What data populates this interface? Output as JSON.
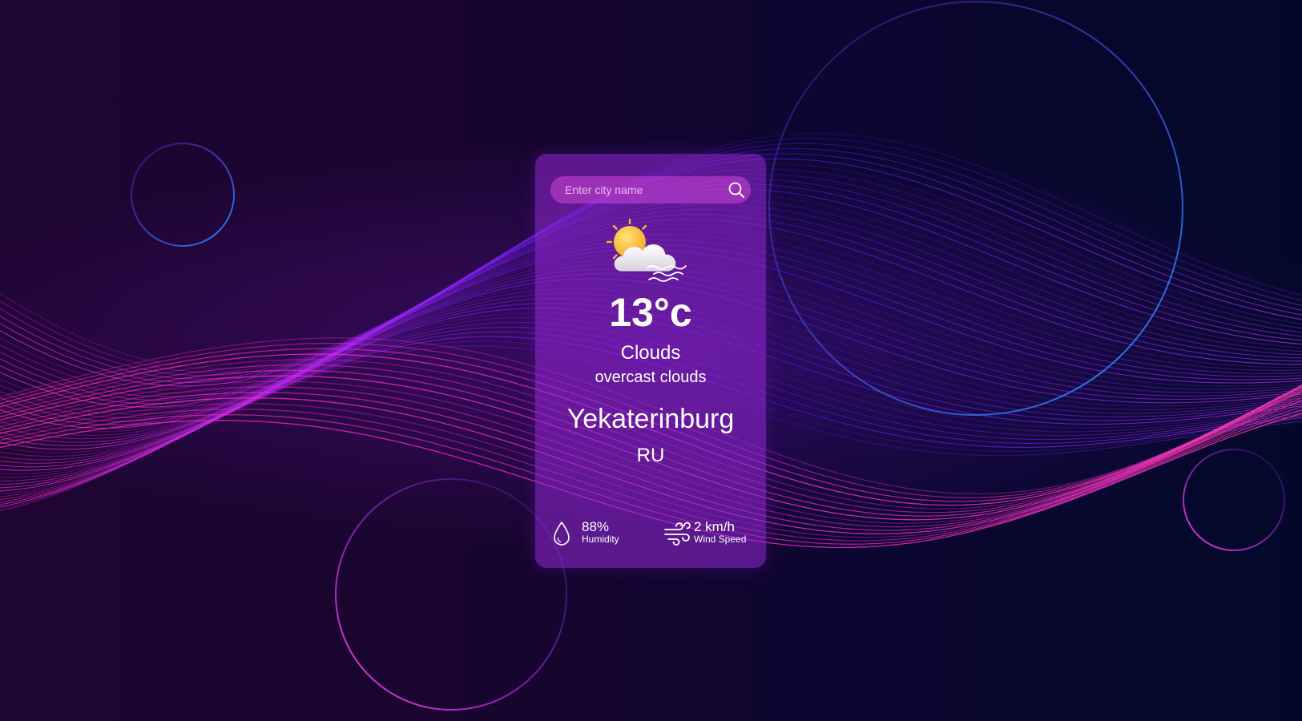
{
  "search": {
    "placeholder": "Enter city name",
    "value": "",
    "icon": "search-icon"
  },
  "weather": {
    "icon": "sun-behind-cloud-icon",
    "temperature": "13°c",
    "condition": "Clouds",
    "description": "overcast clouds",
    "city": "Yekaterinburg",
    "country": "RU"
  },
  "stats": {
    "humidity": {
      "value": "88%",
      "label": "Humidity",
      "icon": "water-drop-icon"
    },
    "wind": {
      "value": "2 km/h",
      "label": "Wind Speed",
      "icon": "wind-icon"
    }
  },
  "colors": {
    "card": "#9628d7",
    "magenta": "#ff1fd2",
    "blue": "#2a6bff",
    "background": "#16052f"
  }
}
